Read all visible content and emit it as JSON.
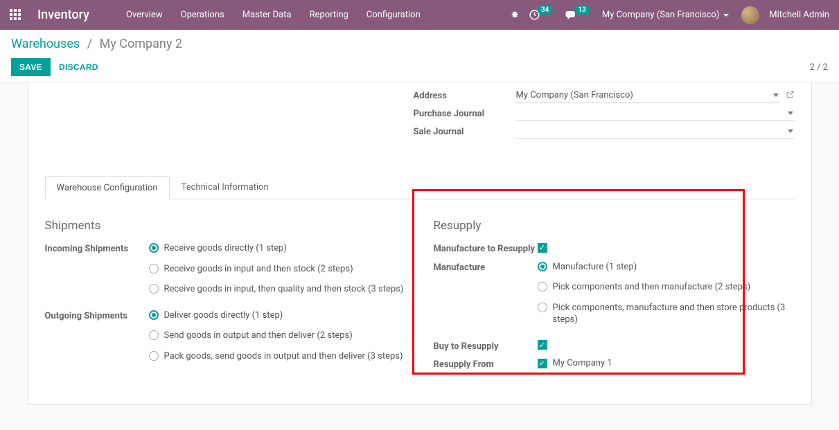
{
  "nav": {
    "app_title": "Inventory",
    "menu": [
      "Overview",
      "Operations",
      "Master Data",
      "Reporting",
      "Configuration"
    ],
    "badge_timer": "34",
    "badge_chat": "13",
    "company": "My Company (San Francisco)",
    "user": "Mitchell Admin"
  },
  "breadcrumb": {
    "root": "Warehouses",
    "current": "My Company 2"
  },
  "buttons": {
    "save": "SAVE",
    "discard": "DISCARD"
  },
  "pager": "2 / 2",
  "top_fields": {
    "address_label": "Address",
    "address_value": "My Company (San Francisco)",
    "purchase_journal_label": "Purchase Journal",
    "sale_journal_label": "Sale Journal"
  },
  "tabs": {
    "config": "Warehouse Configuration",
    "tech": "Technical Information"
  },
  "shipments": {
    "title": "Shipments",
    "incoming_label": "Incoming Shipments",
    "incoming_opts": [
      "Receive goods directly (1 step)",
      "Receive goods in input and then stock (2 steps)",
      "Receive goods in input, then quality and then stock (3 steps)"
    ],
    "outgoing_label": "Outgoing Shipments",
    "outgoing_opts": [
      "Deliver goods directly (1 step)",
      "Send goods in output and then deliver (2 steps)",
      "Pack goods, send goods in output and then deliver (3 steps)"
    ]
  },
  "resupply": {
    "title": "Resupply",
    "manufacture_to_resupply_label": "Manufacture to Resupply",
    "manufacture_label": "Manufacture",
    "manufacture_opts": [
      "Manufacture (1 step)",
      "Pick components and then manufacture (2 steps)",
      "Pick components, manufacture and then store products (3 steps)"
    ],
    "buy_to_resupply_label": "Buy to Resupply",
    "resupply_from_label": "Resupply From",
    "resupply_from_value": "My Company 1"
  }
}
